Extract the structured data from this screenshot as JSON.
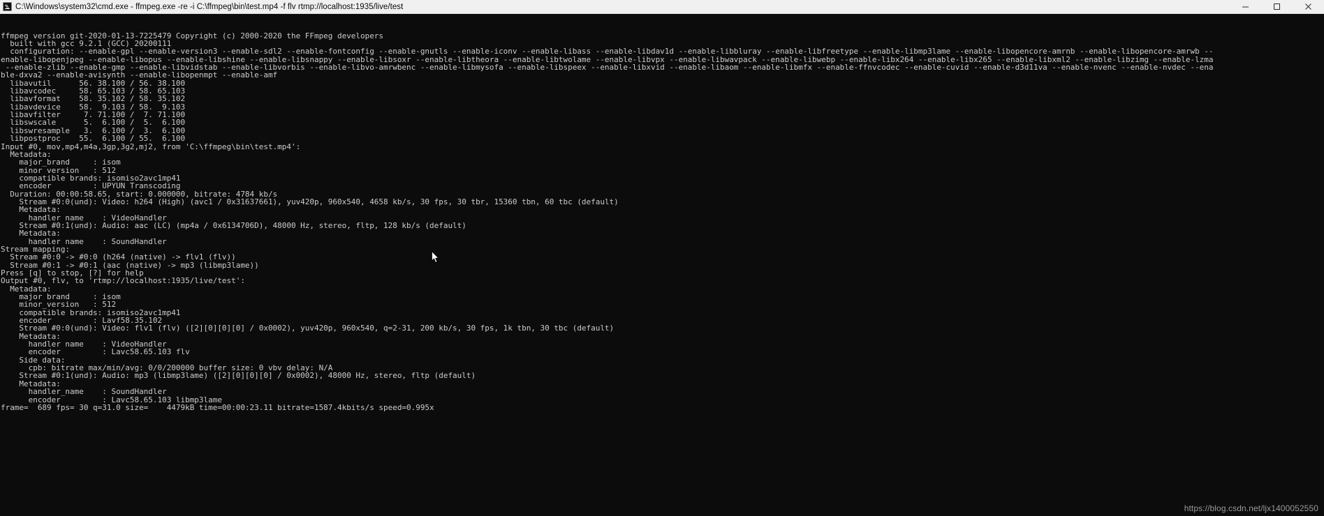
{
  "window": {
    "title": "C:\\Windows\\system32\\cmd.exe - ffmpeg.exe  -re -i C:\\ffmpeg\\bin\\test.mp4 -f flv rtmp://localhost:1935/live/test",
    "icon": "console-icon",
    "controls": {
      "minimize": "minimize-button",
      "maximize": "maximize-button",
      "close": "close-button"
    },
    "background_color": "#0c0c0c",
    "text_color": "#cccccc",
    "titlebar_color": "#f0f0f0"
  },
  "console": {
    "lines": [
      "ffmpeg version git-2020-01-13-7225479 Copyright (c) 2000-2020 the FFmpeg developers",
      "  built with gcc 9.2.1 (GCC) 20200111",
      "  configuration: --enable-gpl --enable-version3 --enable-sdl2 --enable-fontconfig --enable-gnutls --enable-iconv --enable-libass --enable-libdav1d --enable-libbluray --enable-libfreetype --enable-libmp3lame --enable-libopencore-amrnb --enable-libopencore-amrwb --enable-libopenjpeg --enable-libopus --enable-libshine --enable-libsnappy --enable-libsoxr --enable-libtheora --enable-libtwolame --enable-libvpx --enable-libwavpack --enable-libwebp --enable-libx264 --enable-libx265 --enable-libxml2 --enable-libzimg --enable-lzma --enable-zlib --enable-gmp --enable-libvidstab --enable-libvorbis --enable-libvo-amrwbenc --enable-libmysofa --enable-libspeex --enable-libxvid --enable-libaom --enable-libmfx --enable-ffnvcodec --enable-cuvid --enable-d3d11va --enable-nvenc --enable-nvdec --enable-dxva2 --enable-avisynth --enable-libopenmpt --enable-amf",
      "  libavutil      56. 38.100 / 56. 38.100",
      "  libavcodec     58. 65.103 / 58. 65.103",
      "  libavformat    58. 35.102 / 58. 35.102",
      "  libavdevice    58.  9.103 / 58.  9.103",
      "  libavfilter     7. 71.100 /  7. 71.100",
      "  libswscale      5.  6.100 /  5.  6.100",
      "  libswresample   3.  6.100 /  3.  6.100",
      "  libpostproc    55.  6.100 / 55.  6.100",
      "Input #0, mov,mp4,m4a,3gp,3g2,mj2, from 'C:\\ffmpeg\\bin\\test.mp4':",
      "  Metadata:",
      "    major_brand     : isom",
      "    minor_version   : 512",
      "    compatible_brands: isomiso2avc1mp41",
      "    encoder         : UPYUN Transcoding",
      "  Duration: 00:00:58.65, start: 0.000000, bitrate: 4784 kb/s",
      "    Stream #0:0(und): Video: h264 (High) (avc1 / 0x31637661), yuv420p, 960x540, 4658 kb/s, 30 fps, 30 tbr, 15360 tbn, 60 tbc (default)",
      "    Metadata:",
      "      handler_name    : VideoHandler",
      "    Stream #0:1(und): Audio: aac (LC) (mp4a / 0x6134706D), 48000 Hz, stereo, fltp, 128 kb/s (default)",
      "    Metadata:",
      "      handler_name    : SoundHandler",
      "Stream mapping:",
      "  Stream #0:0 -> #0:0 (h264 (native) -> flv1 (flv))",
      "  Stream #0:1 -> #0:1 (aac (native) -> mp3 (libmp3lame))",
      "Press [q] to stop, [?] for help",
      "Output #0, flv, to 'rtmp://localhost:1935/live/test':",
      "  Metadata:",
      "    major_brand     : isom",
      "    minor_version   : 512",
      "    compatible_brands: isomiso2avc1mp41",
      "    encoder         : Lavf58.35.102",
      "    Stream #0:0(und): Video: flv1 (flv) ([2][0][0][0] / 0x0002), yuv420p, 960x540, q=2-31, 200 kb/s, 30 fps, 1k tbn, 30 tbc (default)",
      "    Metadata:",
      "      handler_name    : VideoHandler",
      "      encoder         : Lavc58.65.103 flv",
      "    Side data:",
      "      cpb: bitrate max/min/avg: 0/0/200000 buffer size: 0 vbv_delay: N/A",
      "    Stream #0:1(und): Audio: mp3 (libmp3lame) ([2][0][0][0] / 0x0002), 48000 Hz, stereo, fltp (default)",
      "    Metadata:",
      "      handler_name    : SoundHandler",
      "      encoder         : Lavc58.65.103 libmp3lame",
      "frame=  689 fps= 30 q=31.0 size=    4479kB time=00:00:23.11 bitrate=1587.4kbits/s speed=0.995x"
    ]
  },
  "watermark": {
    "text": "https://blog.csdn.net/ljx1400052550"
  }
}
